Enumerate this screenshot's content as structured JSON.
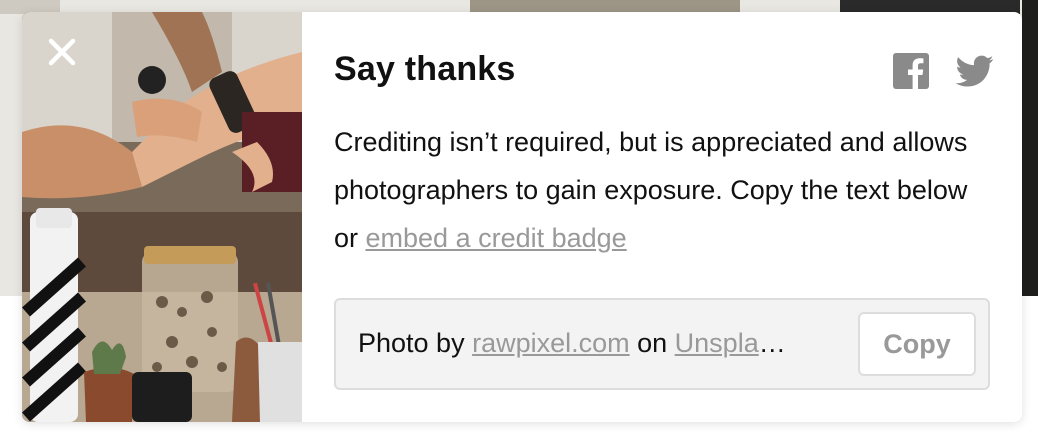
{
  "modal": {
    "title": "Say thanks",
    "description": "Crediting isn’t required, but is appreciated and allows photographers to gain exposure. Copy the text below or ",
    "embed_link": "embed a credit badge",
    "credit": {
      "prefix": "Photo by ",
      "photographer": "rawpixel.com",
      "middle": " on ",
      "site": "Unspla",
      "ellipsis": "…"
    },
    "copy_label": "Copy"
  },
  "icons": {
    "close": "close-icon",
    "facebook": "facebook-icon",
    "twitter": "twitter-icon"
  },
  "colors": {
    "title_text": "#111111",
    "link": "#999999",
    "icon_gray": "#8a8a8a",
    "credit_bg": "#f3f3f3",
    "border": "#dddddd"
  }
}
